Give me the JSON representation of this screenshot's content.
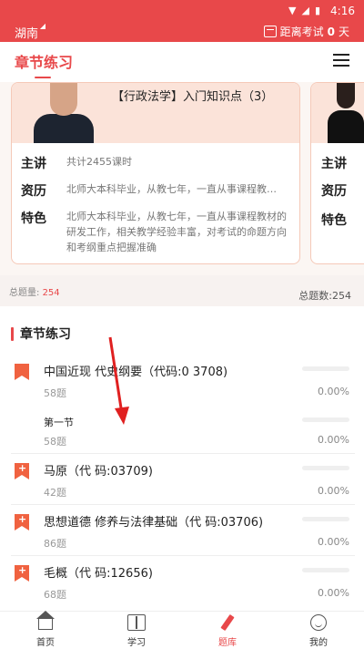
{
  "status_bar": {
    "time": "4:16",
    "icons": [
      "wifi-icon",
      "signal-icon",
      "battery-icon"
    ]
  },
  "top_bar": {
    "province": "湖南",
    "countdown_label": "距离考试",
    "countdown_days": "0",
    "countdown_unit": "天"
  },
  "nav": {
    "title": "章节练习"
  },
  "banner": {
    "course_title": "【行政法学】入门知识点（3）",
    "rows": [
      {
        "key": "主讲",
        "value": "共计2455课时"
      },
      {
        "key": "资历",
        "value": "北师大本科毕业，从教七年，一直从事课程教…"
      },
      {
        "key": "特色",
        "value": "北师大本科毕业，从教七年，一直从事课程教材的研发工作，相关教学经验丰富，对考试的命题方向和考纲重点把握准确"
      }
    ],
    "next_card_labels": [
      "主讲",
      "资历",
      "特色"
    ]
  },
  "totals": {
    "left_label": "总题量:",
    "left_value": "254",
    "right_label": "总题数:",
    "right_value": "254"
  },
  "section": {
    "title": "章节练习",
    "items": [
      {
        "name": "中国近现 代史纲要（代码:0 3708)",
        "count": "58题",
        "percent": "0.00%",
        "icon": "bookmark-icon",
        "progress": 0
      },
      {
        "name": "第一节",
        "count": "58题",
        "percent": "0.00%",
        "sub": true,
        "progress": 0
      },
      {
        "name": "马原（代 码:03709)",
        "count": "42题",
        "percent": "0.00%",
        "icon": "bookmark-plus-icon",
        "progress": 0
      },
      {
        "name": "思想道德 修养与法律基础（代 码:03706)",
        "count": "86题",
        "percent": "0.00%",
        "icon": "bookmark-plus-icon",
        "progress": 0
      },
      {
        "name": "毛概（代 码:12656)",
        "count": "68题",
        "percent": "0.00%",
        "icon": "bookmark-plus-icon",
        "progress": 0
      }
    ]
  },
  "tabbar": {
    "tabs": [
      {
        "label": "首页",
        "icon": "home-icon"
      },
      {
        "label": "学习",
        "icon": "book-icon"
      },
      {
        "label": "题库",
        "icon": "pen-icon",
        "active": true
      },
      {
        "label": "我的",
        "icon": "profile-icon"
      }
    ]
  },
  "colors": {
    "accent": "#e8484a",
    "bookmark": "#f06240"
  }
}
